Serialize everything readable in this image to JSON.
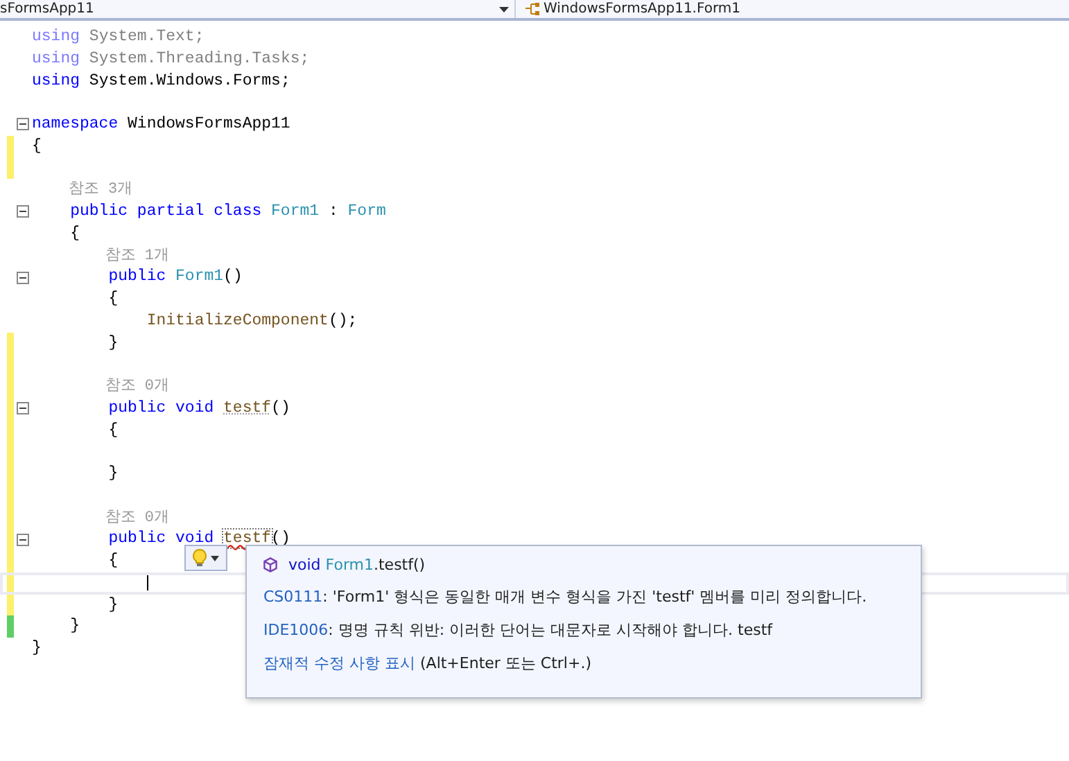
{
  "navigation_bar": {
    "project_dropdown": "sFormsApp11",
    "member_dropdown": "WindowsFormsApp11.Form1"
  },
  "editor": {
    "lines": [
      {
        "foldable": false,
        "unsaved_change": false,
        "saved_change": false,
        "current": false,
        "tokens": [
          {
            "kind": "keyword_faded",
            "text": "using "
          },
          {
            "kind": "plain_faded",
            "text": "System.Text;"
          }
        ]
      },
      {
        "foldable": false,
        "unsaved_change": false,
        "saved_change": false,
        "current": false,
        "tokens": [
          {
            "kind": "keyword_faded",
            "text": "using "
          },
          {
            "kind": "plain_faded",
            "text": "System.Threading.Tasks;"
          }
        ]
      },
      {
        "foldable": false,
        "unsaved_change": false,
        "saved_change": false,
        "current": false,
        "tokens": [
          {
            "kind": "keyword",
            "text": "using "
          },
          {
            "kind": "plain",
            "text": "System.Windows.Forms;"
          }
        ]
      },
      {
        "foldable": false,
        "unsaved_change": false,
        "saved_change": false,
        "current": false
      },
      {
        "foldable": true,
        "unsaved_change": false,
        "saved_change": false,
        "current": false,
        "tokens": [
          {
            "kind": "keyword",
            "text": "namespace "
          },
          {
            "kind": "plain",
            "text": "WindowsFormsApp11"
          }
        ]
      },
      {
        "foldable": false,
        "unsaved_change": true,
        "saved_change": false,
        "current": false,
        "tokens": [
          {
            "kind": "plain",
            "text": "{"
          }
        ]
      },
      {
        "foldable": false,
        "unsaved_change": true,
        "saved_change": false,
        "current": false
      },
      {
        "foldable": false,
        "unsaved_change": false,
        "saved_change": false,
        "current": false,
        "tokens": [
          {
            "kind": "lens",
            "text": "    참조 3개"
          }
        ]
      },
      {
        "foldable": true,
        "unsaved_change": false,
        "saved_change": false,
        "current": false,
        "tokens": [
          {
            "kind": "keyword",
            "text": "    public partial class "
          },
          {
            "kind": "type",
            "text": "Form1"
          },
          {
            "kind": "plain",
            "text": " : "
          },
          {
            "kind": "type",
            "text": "Form"
          }
        ]
      },
      {
        "foldable": false,
        "unsaved_change": false,
        "saved_change": false,
        "current": false,
        "tokens": [
          {
            "kind": "plain",
            "text": "    {"
          }
        ]
      },
      {
        "foldable": false,
        "unsaved_change": false,
        "saved_change": false,
        "current": false,
        "tokens": [
          {
            "kind": "lens",
            "text": "        참조 1개"
          }
        ]
      },
      {
        "foldable": true,
        "unsaved_change": false,
        "saved_change": false,
        "current": false,
        "tokens": [
          {
            "kind": "keyword",
            "text": "        public "
          },
          {
            "kind": "type",
            "text": "Form1"
          },
          {
            "kind": "plain",
            "text": "()"
          }
        ]
      },
      {
        "foldable": false,
        "unsaved_change": false,
        "saved_change": false,
        "current": false,
        "tokens": [
          {
            "kind": "plain",
            "text": "        {"
          }
        ]
      },
      {
        "foldable": false,
        "unsaved_change": false,
        "saved_change": false,
        "current": false,
        "tokens": [
          {
            "kind": "method",
            "text": "            InitializeComponent"
          },
          {
            "kind": "plain",
            "text": "();"
          }
        ]
      },
      {
        "foldable": false,
        "unsaved_change": true,
        "saved_change": false,
        "current": false,
        "tokens": [
          {
            "kind": "plain",
            "text": "        }"
          }
        ]
      },
      {
        "foldable": false,
        "unsaved_change": true,
        "saved_change": false,
        "current": false
      },
      {
        "foldable": false,
        "unsaved_change": true,
        "saved_change": false,
        "current": false,
        "tokens": [
          {
            "kind": "lens",
            "text": "        참조 0개"
          }
        ]
      },
      {
        "foldable": true,
        "unsaved_change": true,
        "saved_change": false,
        "current": false,
        "tokens": [
          {
            "kind": "keyword",
            "text": "        public void "
          },
          {
            "kind": "suggestion",
            "text": "testf"
          },
          {
            "kind": "plain",
            "text": "()"
          }
        ]
      },
      {
        "foldable": false,
        "unsaved_change": true,
        "saved_change": false,
        "current": false,
        "tokens": [
          {
            "kind": "plain",
            "text": "        {"
          }
        ]
      },
      {
        "foldable": false,
        "unsaved_change": true,
        "saved_change": false,
        "current": false
      },
      {
        "foldable": false,
        "unsaved_change": true,
        "saved_change": false,
        "current": false,
        "tokens": [
          {
            "kind": "plain",
            "text": "        }"
          }
        ]
      },
      {
        "foldable": false,
        "unsaved_change": true,
        "saved_change": false,
        "current": false
      },
      {
        "foldable": false,
        "unsaved_change": true,
        "saved_change": false,
        "current": false,
        "tokens": [
          {
            "kind": "lens",
            "text": "        참조 0개"
          }
        ]
      },
      {
        "foldable": true,
        "unsaved_change": true,
        "saved_change": false,
        "current": false,
        "tokens": [
          {
            "kind": "keyword",
            "text": "        public void "
          },
          {
            "kind": "error",
            "text": "testf"
          },
          {
            "kind": "plain",
            "text": "()"
          }
        ]
      },
      {
        "foldable": false,
        "unsaved_change": true,
        "saved_change": false,
        "current": false,
        "tokens": [
          {
            "kind": "plain",
            "text": "        {"
          }
        ]
      },
      {
        "foldable": false,
        "unsaved_change": true,
        "saved_change": false,
        "current": true
      },
      {
        "foldable": false,
        "unsaved_change": true,
        "saved_change": false,
        "current": false,
        "tokens": [
          {
            "kind": "plain",
            "text": "        }"
          }
        ]
      },
      {
        "foldable": false,
        "unsaved_change": false,
        "saved_change": true,
        "current": false,
        "tokens": [
          {
            "kind": "plain",
            "text": "    }"
          }
        ]
      },
      {
        "foldable": false,
        "unsaved_change": false,
        "saved_change": false,
        "current": false,
        "tokens": [
          {
            "kind": "plain",
            "text": "}"
          }
        ]
      }
    ]
  },
  "quick_info": {
    "signature": [
      {
        "kind": "keyword",
        "text": "void "
      },
      {
        "kind": "type",
        "text": "Form1"
      },
      {
        "kind": "plain",
        "text": ".testf()"
      }
    ],
    "diagnostics": [
      {
        "code": "CS0111",
        "message": ": 'Form1' 형식은 동일한 매개 변수 형식을 가진 'testf' 멤버를 미리 정의합니다."
      },
      {
        "code": "IDE1006",
        "message": ": 명명 규칙 위반: 이러한 단어는 대문자로 시작해야 합니다. testf"
      }
    ],
    "fix_link": "잠재적 수정 사항 표시",
    "fix_hint": " (Alt+Enter 또는 Ctrl+.)"
  }
}
